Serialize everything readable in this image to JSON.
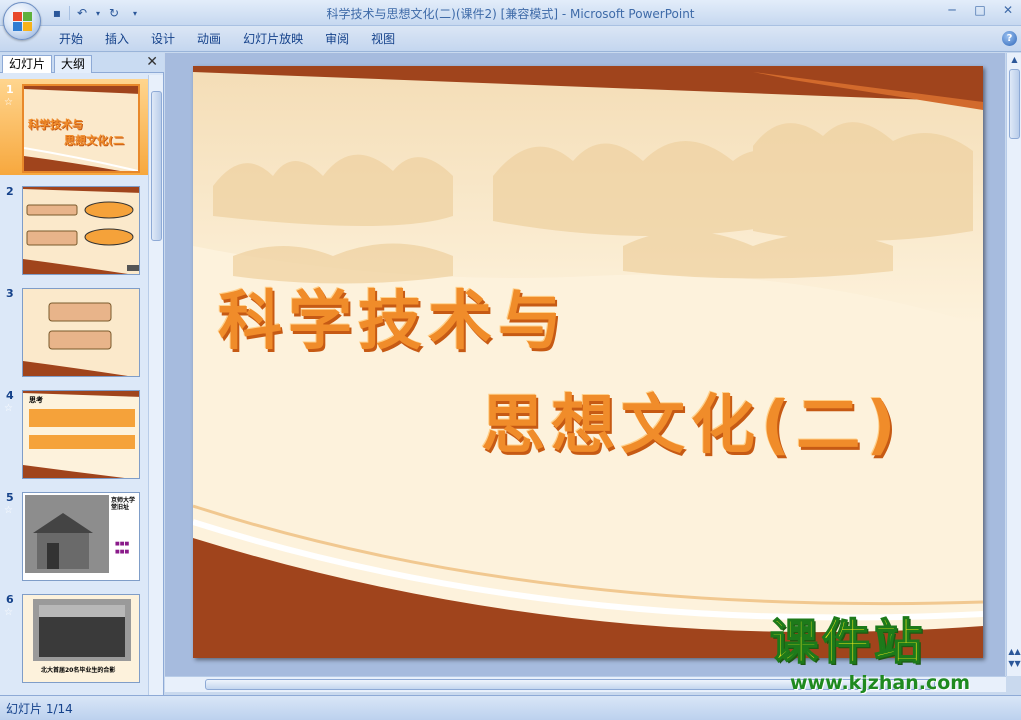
{
  "window": {
    "title": "科学技术与思想文化(二)(课件2) [兼容模式] - Microsoft PowerPoint",
    "quick_access": [
      "save-icon",
      "undo-icon",
      "redo-icon",
      "customize-icon"
    ],
    "controls": [
      "minimize-icon",
      "maximize-icon",
      "close-icon"
    ]
  },
  "ribbon": {
    "tabs": [
      "开始",
      "插入",
      "设计",
      "动画",
      "幻灯片放映",
      "审阅",
      "视图"
    ]
  },
  "left_pane": {
    "tabs": [
      "幻灯片",
      "大纲"
    ],
    "active_tab": 0,
    "slides": [
      {
        "number": "1",
        "has_animation": true,
        "selected": true
      },
      {
        "number": "2",
        "has_animation": false,
        "selected": false
      },
      {
        "number": "3",
        "has_animation": false,
        "selected": false
      },
      {
        "number": "4",
        "has_animation": true,
        "selected": false
      },
      {
        "number": "5",
        "has_animation": true,
        "selected": false
      },
      {
        "number": "6",
        "has_animation": true,
        "selected": false
      }
    ],
    "animation_mark": "☆"
  },
  "slide": {
    "title_line1": "科学技术与",
    "title_line2": "思想文化(二)",
    "colors": {
      "title": "#f08c2a",
      "band": "#a0441c",
      "background": "#fdf2dc"
    }
  },
  "thumb_text": {
    "s1_line1": "科学技术与",
    "s1_line2": "思想文化(二",
    "s4_heading": "思考",
    "s5_heading": "京师大学堂旧址",
    "s6_caption": "北大首届20名毕业生的合影"
  },
  "status": {
    "slide_indicator": "幻灯片 1/14"
  },
  "watermark": {
    "main": "课件站",
    "sub": "www.kjzhan.com"
  }
}
